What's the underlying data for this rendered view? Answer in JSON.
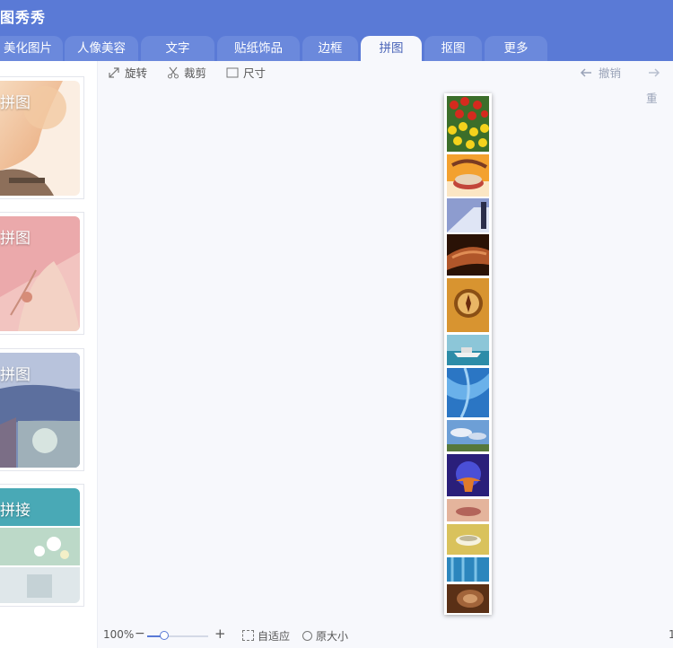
{
  "app": {
    "title": "图秀秀"
  },
  "tabs": [
    {
      "label": "美化图片",
      "active": false
    },
    {
      "label": "人像美容",
      "active": false
    },
    {
      "label": "文字",
      "active": false
    },
    {
      "label": "贴纸饰品",
      "active": false
    },
    {
      "label": "边框",
      "active": false
    },
    {
      "label": "拼图",
      "active": true
    },
    {
      "label": "抠图",
      "active": false
    },
    {
      "label": "更多",
      "active": false
    }
  ],
  "toolbar": {
    "rotate": "旋转",
    "crop": "裁剪",
    "size": "尺寸",
    "undo": "撤销",
    "redo": "重"
  },
  "templates": [
    {
      "label": "拼图"
    },
    {
      "label": "拼图"
    },
    {
      "label": "拼图"
    },
    {
      "label": "拼接"
    }
  ],
  "bottom": {
    "zoom": "100%",
    "zoom_level": 0.28,
    "minus": "−",
    "plus": "+",
    "fit": "自适应",
    "original": "原大小",
    "page": "1"
  },
  "colors": {
    "accent": "#5a7ad6",
    "tab": "#6b89dc",
    "bg": "#f7f8fc"
  }
}
